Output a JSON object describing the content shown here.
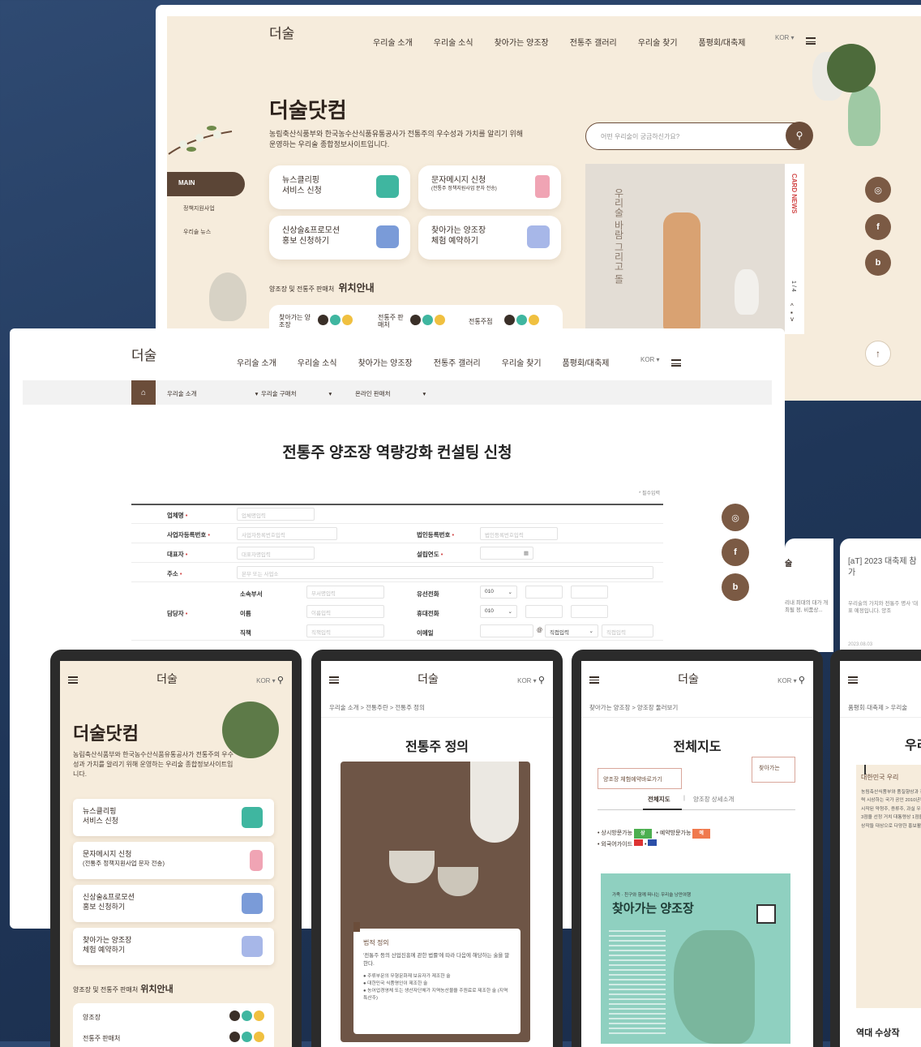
{
  "nav": {
    "logo": "더술",
    "items": [
      "우리술 소개",
      "우리술 소식",
      "찾아가는 양조장",
      "전통주 갤러리",
      "우리술 찾기",
      "품평회/대축제"
    ],
    "lang": "KOR ▾"
  },
  "hero": {
    "title": "더술닷컴",
    "desc_line1": "농림축산식품부와 한국농수산식품유통공사가 전통주의 우수성과 가치를 알리기 위해",
    "desc_line2": "운영하는 우리술 종합정보사이트입니다.",
    "search_placeholder": "어떤 우리술이 궁금하신가요?",
    "cards": [
      {
        "line1": "뉴스클리핑",
        "line2": "서비스 신청"
      },
      {
        "line1": "문자메시지 신청",
        "line2": "(전통주 정책지원사업 문자 전송)"
      },
      {
        "line1": "신상술&프로모션",
        "line2": "홍보 신청하기"
      },
      {
        "line1": "찾아가는 양조장",
        "line2": "체험 예약하기"
      }
    ],
    "location_label_small": "양조장 및 전통주 판매처",
    "location_label_big": "위치안내",
    "loc_items": [
      "찾아가는 양조장",
      "전통주 판매처",
      "전통주점"
    ],
    "side_menu": [
      "MAIN",
      "정책지원사업",
      "우리술 뉴스"
    ],
    "card_news": "CARD NEWS",
    "card_counter": "1 / 4",
    "poem": "우리술 바람 그리고 돌"
  },
  "form_page": {
    "subnav": [
      "우리술 소개",
      "우리술 구매처",
      "온라인 판매처"
    ],
    "title": "전통주 양조장 역량강화 컨설팅 신청",
    "required_note": "* 필수입력",
    "fields": {
      "company": "업체명",
      "company_ph": "업체명입력",
      "bizno": "사업자등록번호",
      "bizno_ph": "사업자등록번호입력",
      "corpno": "법인등록번호",
      "corpno_ph": "법인등록번호입력",
      "ceo": "대표자",
      "ceo_ph": "대표자명입력",
      "founded": "설립연도",
      "address": "주소",
      "address_ph": "본부 또는 사업소",
      "manager": "담당자",
      "dept": "소속부서",
      "dept_ph": "부서명입력",
      "name": "이름",
      "name_ph": "이름입력",
      "position": "직책",
      "position_ph": "직책입력",
      "tel": "유선전화",
      "mobile": "휴대전화",
      "email": "이메일",
      "phone_prefix": "010",
      "email_domain": "직접입력",
      "email_domain_ph": "직접입력"
    },
    "right_card1": "[aT] 2023 대축제 참가",
    "right_card1_text": "우리술의 가치와 전통주 명사 '대표 예정입니다. 양조",
    "right_card1_date": "2023.08.03",
    "right_fragment": "술",
    "right_fragment_text": "리내 최대의 대가 개최될 정, 비품상..."
  },
  "mobile1": {
    "title": "더술닷컴",
    "desc": "농림축산식품부와 한국농수산식품유통공사가 전통주의 우수성과 가치를 알리기 위해 운영하는 우리술 종합정보사이트입니다.",
    "cards": [
      {
        "line1": "뉴스클리핑",
        "line2": "서비스 신청"
      },
      {
        "line1": "문자메시지 신청",
        "line2": "(전통주 정책지원사업 문자 전송)"
      },
      {
        "line1": "신상술&프로모션",
        "line2": "홍보 신청하기"
      },
      {
        "line1": "찾아가는 양조장",
        "line2": "체험 예약하기"
      }
    ],
    "loc_small": "양조장 및 전통주 판매처",
    "loc_big": "위치안내",
    "loc_rows": [
      "양조장",
      "전통주 판매처"
    ]
  },
  "mobile2": {
    "crumb": "우리술 소개 > 전통주란 > 전통주 정의",
    "title": "전통주 정의",
    "legal_title": "법적 정의",
    "legal_text": "'전통주 등의 산업진흥에 관한 법률'에 따라 다음에 해당하는 술을 말한다.",
    "bullets": [
      "주류부문의 무형문화재 보유자가 제조한 술",
      "대한민국 식품명인이 제조한 술",
      "농어업경영체 또는 생산자단체가 지역농산물을 주원료로 제조한 술 (지역특산주)"
    ]
  },
  "mobile3": {
    "crumb": "찾아가는 양조장 > 양조장 둘러보기",
    "title": "전체지도",
    "btn_reserve": "양조장 체험예약바로가기",
    "btn_find": "찾아가는",
    "tab1": "전체지도",
    "tab2": "양조장 상세소개",
    "legend1": "상시방문가능",
    "legend1_badge": "상",
    "legend2": "예약방문가능",
    "legend2_badge": "예",
    "legend3": "외국어가이드",
    "map_sub": "가족 · 친구와 함께 떠나는 우리술 낭만여행",
    "map_title": "찾아가는 양조장"
  },
  "mobile4": {
    "crumb": "품평회·대축제 > 우리술",
    "title": "우리",
    "heading": "대한민국 우리",
    "text": "농림축산식품부와 품질향상과 경쟁력 시상하는 국가 공인 2010년부터 시작된 약청주, 증류주, 과실 우수상 3점을 선정 거치 대통령상 1점을 수상작들 대상으로 다양한 홍보활동이",
    "awards": "역대 수상작"
  },
  "colors": {
    "beige": "#f6ecdc",
    "dark_brown": "#3a2f28",
    "accent_brown": "#6b4d3a",
    "required_red": "#d24a4a"
  }
}
